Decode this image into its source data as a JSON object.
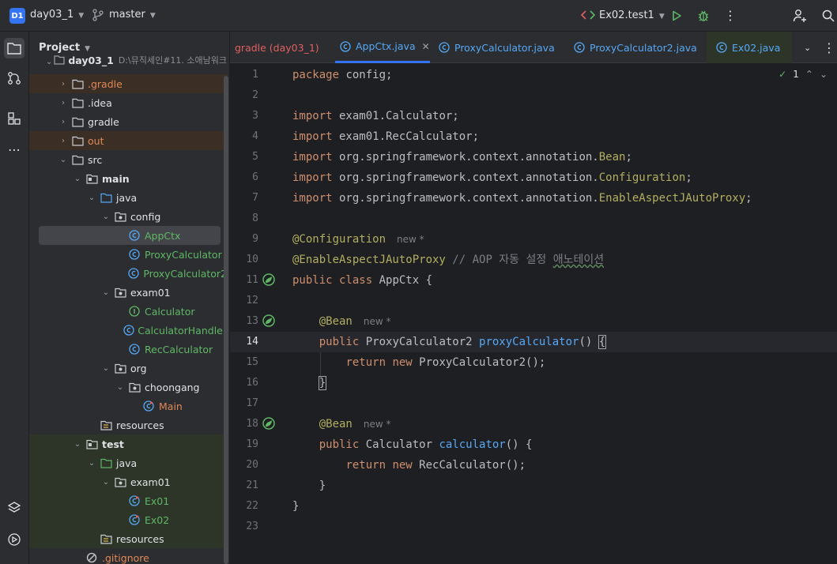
{
  "topbar": {
    "project_badge": "D1",
    "project_name": "day03_1",
    "branch": "master",
    "run_config": "Ex02.test1"
  },
  "project_panel": {
    "title": "Project",
    "root_partial": "day03_1",
    "root_path_partial": "D:\\뮤직세인#11. 소애남워크"
  },
  "tree": [
    {
      "label": ".gradle",
      "style": "orange"
    },
    {
      "label": ".idea",
      "style": "normal"
    },
    {
      "label": "gradle",
      "style": "normal"
    },
    {
      "label": "out",
      "style": "orange"
    },
    {
      "label": "src",
      "style": "normal"
    },
    {
      "label": "main",
      "style": "bold"
    },
    {
      "label": "java",
      "style": "normal"
    },
    {
      "label": "config",
      "style": "normal"
    },
    {
      "label": "AppCtx",
      "style": "green"
    },
    {
      "label": "ProxyCalculator",
      "style": "green"
    },
    {
      "label": "ProxyCalculator2",
      "style": "green"
    },
    {
      "label": "exam01",
      "style": "normal"
    },
    {
      "label": "Calculator",
      "style": "green"
    },
    {
      "label": "CalculatorHandler",
      "style": "green"
    },
    {
      "label": "RecCalculator",
      "style": "green"
    },
    {
      "label": "org",
      "style": "normal"
    },
    {
      "label": "choongang",
      "style": "normal"
    },
    {
      "label": "Main",
      "style": "orange"
    },
    {
      "label": "resources",
      "style": "normal"
    },
    {
      "label": "test",
      "style": "bold"
    },
    {
      "label": "java",
      "style": "normal"
    },
    {
      "label": "exam01",
      "style": "normal"
    },
    {
      "label": "Ex01",
      "style": "green"
    },
    {
      "label": "Ex02",
      "style": "green"
    },
    {
      "label": "resources",
      "style": "normal"
    },
    {
      "label": ".gitignore",
      "style": "orange"
    }
  ],
  "tabs": [
    {
      "label": "gradle (day03_1)"
    },
    {
      "label": "AppCtx.java",
      "active": true
    },
    {
      "label": "ProxyCalculator.java"
    },
    {
      "label": "ProxyCalculator2.java"
    },
    {
      "label": "Ex02.java"
    }
  ],
  "editor": {
    "inspection_count": "1",
    "line_numbers": [
      "1",
      "2",
      "3",
      "4",
      "5",
      "6",
      "7",
      "8",
      "9",
      "10",
      "11",
      "12",
      "13",
      "14",
      "15",
      "16",
      "17",
      "18",
      "19",
      "20",
      "21",
      "22",
      "23"
    ],
    "hint_new": "new *",
    "code": {
      "l1_kw": "package",
      "l1_rest": " config;",
      "l3_kw": "import",
      "l3_rest": " exam01.Calculator;",
      "l4_kw": "import",
      "l4_rest": " exam01.RecCalculator;",
      "l5_kw": "import",
      "l5_rest": " org.springframework.context.annotation.",
      "l5_an": "Bean",
      "l5_end": ";",
      "l6_kw": "import",
      "l6_rest": " org.springframework.context.annotation.",
      "l6_an": "Configuration",
      "l6_end": ";",
      "l7_kw": "import",
      "l7_rest": " org.springframework.context.annotation.",
      "l7_an": "EnableAspectJAutoProxy",
      "l7_end": ";",
      "l9_an": "@Configuration",
      "l10_an": "@EnableAspectJAutoProxy",
      "l10_cm": " // AOP 자동 설정 ",
      "l10_cmu": "애노테이션",
      "l11_kw": "public class",
      "l11_rest": " AppCtx {",
      "l13_an": "@Bean",
      "l14_kw": "public",
      "l14_type": " ProxyCalculator2 ",
      "l14_fn": "proxyCalculator",
      "l14_paren": "() ",
      "l14_brace": "{",
      "l15_kw": "return new",
      "l15_rest": " ProxyCalculator2();",
      "l16_brace": "}",
      "l18_an": "@Bean",
      "l19_kw": "public",
      "l19_type": " Calculator ",
      "l19_fn": "calculator",
      "l19_rest": "() {",
      "l20_kw": "return new",
      "l20_rest": " RecCalculator();",
      "l21": "}",
      "l22": "}"
    }
  },
  "colors": {
    "accent": "#3574f0",
    "keyword": "#cf8e6d",
    "annotation": "#b3ae60",
    "function": "#56a8f5",
    "vcs_green": "#5fb865",
    "vcs_orange": "#e08855"
  }
}
